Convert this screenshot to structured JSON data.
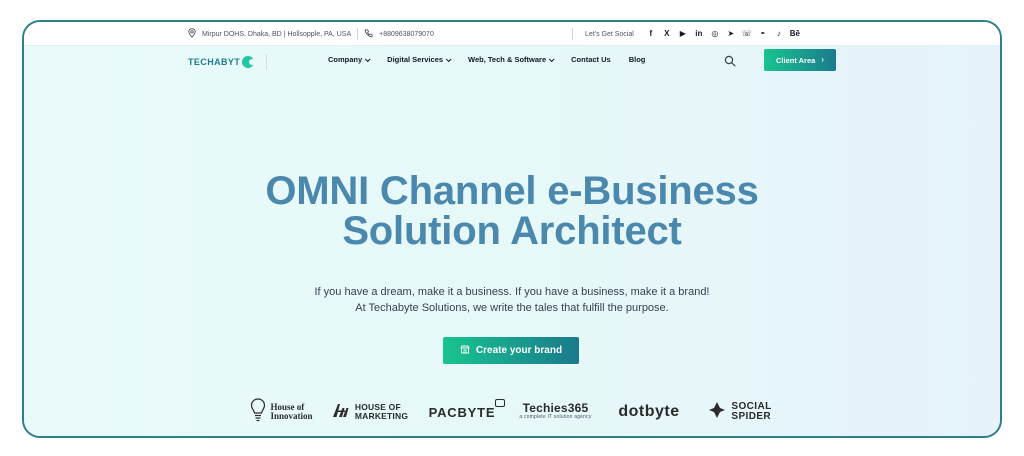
{
  "topbar": {
    "address": "Mirpur DOHS, Dhaka, BD | Hollsopple, PA, USA",
    "phone": "+8809638079070",
    "social_label": "Let's Get Social",
    "social_icons": [
      {
        "name": "facebook-icon",
        "glyph": "f"
      },
      {
        "name": "x-icon",
        "glyph": "X"
      },
      {
        "name": "youtube-icon",
        "glyph": "▶"
      },
      {
        "name": "linkedin-icon",
        "glyph": "in"
      },
      {
        "name": "instagram-icon",
        "glyph": "◎"
      },
      {
        "name": "telegram-icon",
        "glyph": "➤"
      },
      {
        "name": "whatsapp-icon",
        "glyph": "☏"
      },
      {
        "name": "discord-icon",
        "glyph": "◓"
      },
      {
        "name": "tiktok-icon",
        "glyph": "♪"
      },
      {
        "name": "behance-icon",
        "glyph": "Bē"
      }
    ]
  },
  "nav": {
    "logo_text": "TECHABYT",
    "items": [
      {
        "label": "Company",
        "dropdown": true
      },
      {
        "label": "Digital Services",
        "dropdown": true
      },
      {
        "label": "Web, Tech & Software",
        "dropdown": true
      },
      {
        "label": "Contact Us",
        "dropdown": false
      },
      {
        "label": "Blog",
        "dropdown": false
      }
    ],
    "search_icon": "search-icon",
    "client_area_label": "Client Area",
    "client_area_arrow": "›"
  },
  "hero": {
    "headline_line1": "OMNI Channel e-Business",
    "headline_line2": "Solution Architect",
    "subtext_line1": "If you have a dream, make it a business. If you have a business, make it a brand!",
    "subtext_line2": "At Techabyte Solutions, we write the tales that fulfill the purpose.",
    "cta_label": "Create your brand",
    "cta_icon": "shop-icon"
  },
  "partners": {
    "house_of_innovation": {
      "line1": "House of",
      "line2": "Innovation"
    },
    "house_of_marketing": {
      "line1": "HOUSE OF",
      "line2": "MARKETING"
    },
    "pacbyte": "PACBYTE",
    "techies365": {
      "main": "Techies365",
      "tagline": "a complete IT solution agency"
    },
    "dotbyte": "dotbyte",
    "social_spider": {
      "line1": "SOCIAL",
      "line2": "SPIDER"
    }
  },
  "colors": {
    "accent_gradient_start": "#18c48f",
    "accent_gradient_end": "#1a7a8c",
    "headline": "#4b88ad",
    "frame": "#2e7f8d"
  }
}
